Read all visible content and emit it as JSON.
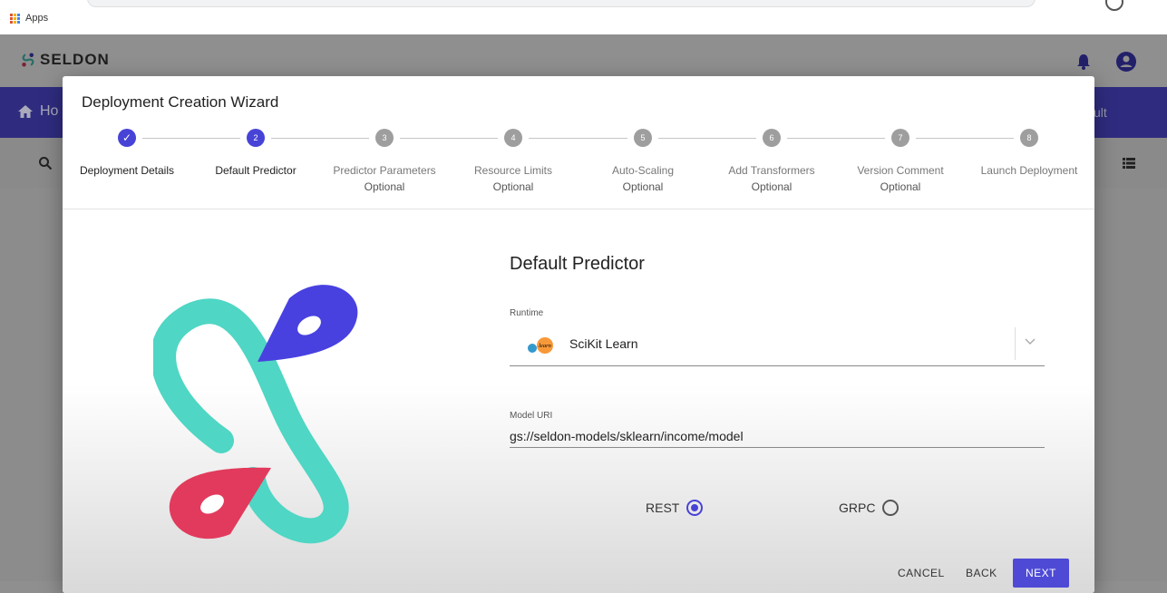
{
  "browser": {
    "apps_label": "Apps"
  },
  "app": {
    "brand": "SELDON",
    "nav_home": "Ho",
    "nav_right": "ult"
  },
  "dialog": {
    "title": "Deployment Creation Wizard",
    "steps": [
      {
        "number": "✓",
        "label": "Deployment Details",
        "optional": "",
        "state": "done"
      },
      {
        "number": "2",
        "label": "Default Predictor",
        "optional": "",
        "state": "active"
      },
      {
        "number": "3",
        "label": "Predictor Parameters",
        "optional": "Optional",
        "state": "pending"
      },
      {
        "number": "4",
        "label": "Resource Limits",
        "optional": "Optional",
        "state": "pending"
      },
      {
        "number": "5",
        "label": "Auto-Scaling",
        "optional": "Optional",
        "state": "pending"
      },
      {
        "number": "6",
        "label": "Add Transformers",
        "optional": "Optional",
        "state": "pending"
      },
      {
        "number": "7",
        "label": "Version Comment",
        "optional": "Optional",
        "state": "pending"
      },
      {
        "number": "8",
        "label": "Launch Deployment",
        "optional": "",
        "state": "pending"
      }
    ],
    "form": {
      "title": "Default Predictor",
      "runtime_label": "Runtime",
      "runtime_value": "SciKit Learn",
      "sklearn_icon_text": "learn",
      "model_uri_label": "Model URI",
      "model_uri_value": "gs://seldon-models/sklearn/income/model",
      "protocols": [
        {
          "label": "REST",
          "checked": true
        },
        {
          "label": "GRPC",
          "checked": false
        }
      ]
    },
    "actions": {
      "cancel": "CANCEL",
      "back": "BACK",
      "next": "NEXT"
    }
  },
  "colors": {
    "accent": "#4843d7",
    "nav": "#2f2c80",
    "logo_teal": "#4fd6c4",
    "logo_blue": "#4841e0",
    "logo_red": "#e23a5c"
  }
}
